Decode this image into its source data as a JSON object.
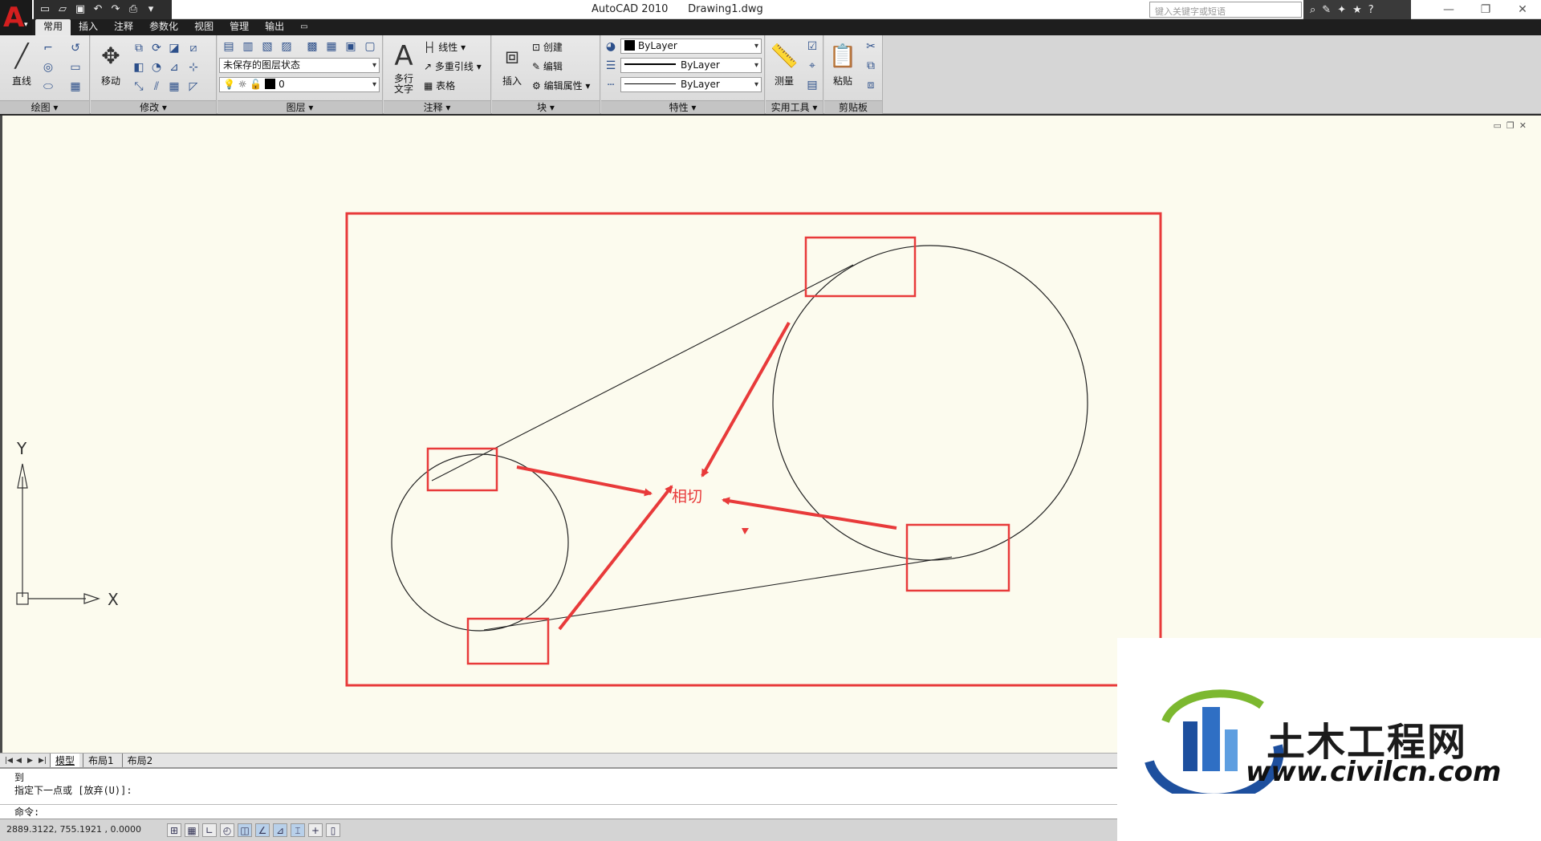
{
  "window": {
    "title": "AutoCAD 2010      Drawing1.dwg",
    "search_placeholder": "键入关键字或短语",
    "minimize": "—",
    "restore": "❐",
    "close": "✕"
  },
  "ribbon": {
    "tabs": [
      {
        "label": "常用",
        "active": true
      },
      {
        "label": "插入"
      },
      {
        "label": "注释"
      },
      {
        "label": "参数化"
      },
      {
        "label": "视图"
      },
      {
        "label": "管理"
      },
      {
        "label": "输出"
      }
    ],
    "panels": {
      "draw": {
        "title": "绘图",
        "line_label": "直线"
      },
      "modify": {
        "title": "修改",
        "move_label": "移动"
      },
      "layers": {
        "title": "图层",
        "state_value": "未保存的图层状态",
        "current_layer": "0"
      },
      "annotation": {
        "title": "注释",
        "mtext_label": "多行\n文字",
        "linear_label": "线性",
        "mleader_label": "多重引线",
        "table_label": "表格"
      },
      "block": {
        "title": "块",
        "insert_label": "插入",
        "create_label": "创建",
        "edit_label": "编辑",
        "edit_attr_label": "编辑属性"
      },
      "properties": {
        "title": "特性",
        "color_value": "ByLayer",
        "linetype_value": "ByLayer",
        "lineweight_value": "ByLayer"
      },
      "utilities": {
        "title": "实用工具",
        "measure_label": "测量"
      },
      "clipboard": {
        "title": "剪贴板",
        "paste_label": "粘贴"
      }
    }
  },
  "drawing": {
    "annotation_label": "相切",
    "ucs_x": "X",
    "ucs_y": "Y"
  },
  "layout_tabs": [
    "模型",
    "布局1",
    "布局2"
  ],
  "command": {
    "history": [
      "到",
      "指定下一点或 [放弃(U)]:"
    ],
    "prompt": "命令:"
  },
  "status": {
    "coordinates": "2889.3122, 755.1921 , 0.0000"
  },
  "watermark": {
    "brand": "土木工程网",
    "url": "www.civilcn.com"
  },
  "colors": {
    "accent_red": "#e83a3a",
    "canvas_bg": "#fcfbee"
  }
}
